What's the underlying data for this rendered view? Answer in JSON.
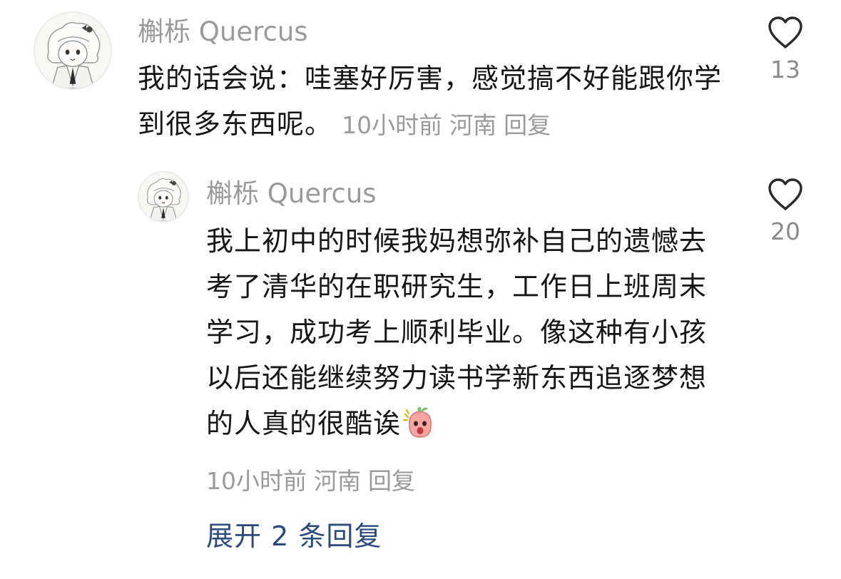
{
  "comments": [
    {
      "username": "槲栎 Quercus",
      "text": "我的话会说：哇塞好厉害，感觉搞不好能跟你学到很多东西呢。",
      "time": "10小时前",
      "location": "河南",
      "reply_label": "回复",
      "likes": "13"
    },
    {
      "username": "槲栎 Quercus",
      "text": "我上初中的时候我妈想弥补自己的遗憾去考了清华的在职研究生，工作日上班周末学习，成功考上顺利毕业。像这种有小孩以后还能继续努力读书学新东西追逐梦想的人真的很酷诶",
      "time": "10小时前",
      "location": "河南",
      "reply_label": "回复",
      "likes": "20",
      "sticker_icon": "shocked-peach-sticker"
    }
  ],
  "expand_replies": "展开 2 条回复",
  "colors": {
    "username": "#9a9a9a",
    "meta": "#9a9a9a",
    "text": "#161616",
    "link": "#2b4a7e",
    "sticker": "#f6a5a5"
  },
  "icons": {
    "like": "heart-outline-icon",
    "avatar": "anime-girl-avatar"
  }
}
